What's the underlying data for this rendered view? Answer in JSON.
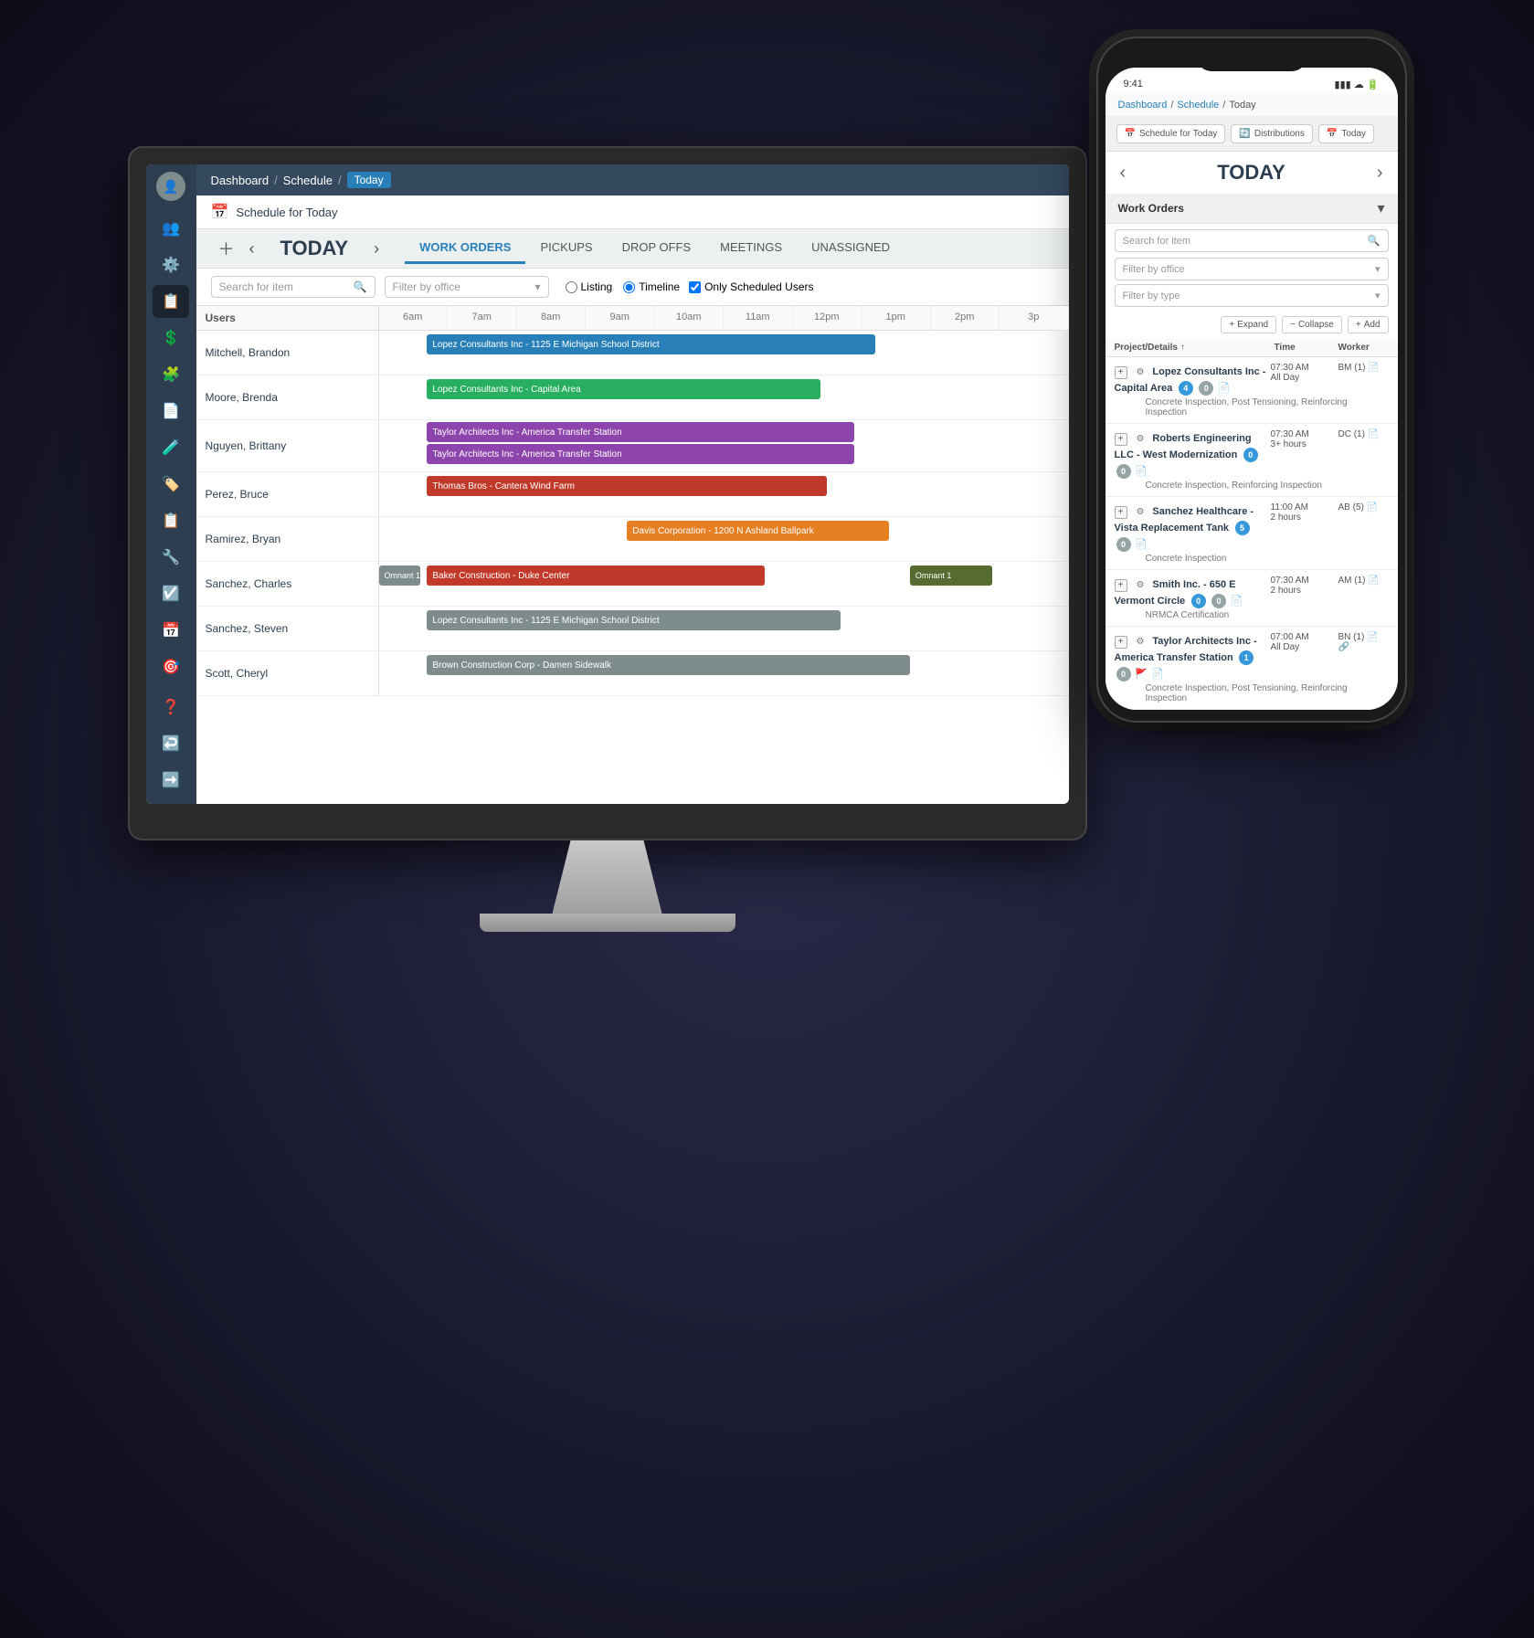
{
  "meta": {
    "bg_dark": "#1a1a2e"
  },
  "breadcrumb": {
    "home": "Dashboard",
    "section": "Schedule",
    "current": "Today",
    "sep": "/"
  },
  "schedule": {
    "title": "Schedule for Today",
    "today_label": "TODAY"
  },
  "nav_tabs": [
    {
      "label": "WORK ORDERS",
      "active": true
    },
    {
      "label": "PICKUPS",
      "active": false
    },
    {
      "label": "DROP OFFS",
      "active": false
    },
    {
      "label": "MEETINGS",
      "active": false
    },
    {
      "label": "UNASSIGNED",
      "active": false
    }
  ],
  "filters": {
    "search_placeholder": "Search for item",
    "office_placeholder": "Filter by office",
    "listing_label": "Listing",
    "timeline_label": "Timeline",
    "scheduled_users_label": "Only Scheduled Users"
  },
  "time_slots": [
    "6am",
    "7am",
    "8am",
    "9am",
    "10am",
    "11am",
    "12pm",
    "1pm",
    "2pm",
    "3p"
  ],
  "users_col_label": "Users",
  "timeline_rows": [
    {
      "user": "Mitchell, Brandon",
      "events": [
        {
          "label": "Lopez Consultants Inc - 1125 E Michigan School District",
          "color": "#2980b9",
          "left": "7%",
          "width": "65%"
        }
      ]
    },
    {
      "user": "Moore, Brenda",
      "events": [
        {
          "label": "Lopez Consultants Inc - Capital Area",
          "color": "#27ae60",
          "left": "7%",
          "width": "57%"
        }
      ]
    },
    {
      "user": "Nguyen, Brittany",
      "events": [
        {
          "label": "Taylor Architects Inc - America Transfer Station",
          "color": "#8e44ad",
          "left": "7%",
          "width": "62%"
        },
        {
          "label": "Taylor Architects Inc - America Transfer Station",
          "color": "#8e44ad",
          "left": "7%",
          "width": "62%",
          "row": 2
        }
      ]
    },
    {
      "user": "Perez, Bruce",
      "events": [
        {
          "label": "Thomas Bros - Cantera Wind Farm",
          "color": "#c0392b",
          "left": "7%",
          "width": "58%"
        }
      ]
    },
    {
      "user": "Ramirez, Bryan",
      "events": [
        {
          "label": "Davis Corporation - 1200 N Ashland Ballpark",
          "color": "#e67e22",
          "left": "36%",
          "width": "38%"
        }
      ]
    },
    {
      "user": "Sanchez, Charles",
      "events": [
        {
          "label": "Omnant 1",
          "color": "#7f8c8d",
          "left": "0%",
          "width": "6%"
        },
        {
          "label": "Baker Construction - Duke Center",
          "color": "#c0392b",
          "left": "7%",
          "width": "49%"
        },
        {
          "label": "Omnant 1",
          "color": "#7f8c8d",
          "left": "76%",
          "width": "10%"
        }
      ]
    },
    {
      "user": "Sanchez, Steven",
      "events": [
        {
          "label": "Lopez Consultants Inc - 1125 E Michigan School District",
          "color": "#7f8c8d",
          "left": "7%",
          "width": "60%"
        }
      ]
    },
    {
      "user": "Scott, Cheryl",
      "events": [
        {
          "label": "Brown Construction Corp - Damen Sidewalk",
          "color": "#7f8c8d",
          "left": "7%",
          "width": "70%"
        }
      ]
    }
  ],
  "phone": {
    "breadcrumb": [
      "Dashboard",
      "/",
      "Schedule",
      "/",
      "Today"
    ],
    "toolbar": {
      "schedule_btn": "Schedule for Today",
      "distributions_btn": "Distributions",
      "today_btn": "Today"
    },
    "today_title": "TODAY",
    "section": "Work Orders",
    "search_placeholder": "Search for item",
    "filter_office_placeholder": "Filter by office",
    "filter_type_placeholder": "Filter by type",
    "expand_btn": "Expand",
    "collapse_btn": "Collapse",
    "add_btn": "Add",
    "table_headers": [
      "Project/Details ↑",
      "Time",
      "Worker"
    ],
    "work_items": [
      {
        "project": "Lopez Consultants Inc - Capital Area",
        "badges": [
          {
            "val": "4",
            "color": "blue"
          },
          {
            "val": "0",
            "color": "gray"
          }
        ],
        "time": "07:30 AM\nAll Day",
        "worker": "BM (1)",
        "detail": "Concrete Inspection, Post Tensioning, Reinforcing Inspection",
        "has_gear": true,
        "has_expand": true,
        "has_doc": true
      },
      {
        "project": "Roberts Engineering LLC - West Modernization",
        "badges": [
          {
            "val": "0",
            "color": "blue"
          },
          {
            "val": "0",
            "color": "gray"
          }
        ],
        "time": "07:30 AM\n3+ hours",
        "worker": "DC (1)",
        "detail": "Concrete Inspection, Reinforcing Inspection",
        "has_gear": true,
        "has_expand": true,
        "has_doc": true
      },
      {
        "project": "Sanchez Healthcare - Vista Replacement Tank",
        "badges": [
          {
            "val": "5",
            "color": "blue"
          },
          {
            "val": "0",
            "color": "gray"
          }
        ],
        "time": "11:00 AM\n2 hours",
        "worker": "AB (5)",
        "detail": "Concrete Inspection",
        "has_gear": true,
        "has_expand": true,
        "has_doc": true
      },
      {
        "project": "Smith Inc. - 650 E Vermont Circle",
        "badges": [
          {
            "val": "0",
            "color": "blue"
          },
          {
            "val": "0",
            "color": "gray"
          }
        ],
        "time": "07:30 AM\n2 hours",
        "worker": "AM (1)",
        "detail": "NRMCA Certification",
        "has_gear": true,
        "has_expand": true,
        "has_doc": true
      },
      {
        "project": "Taylor Architects Inc - America Transfer Station",
        "badges": [
          {
            "val": "1",
            "color": "blue"
          },
          {
            "val": "0",
            "color": "gray"
          }
        ],
        "time": "07:00 AM\nAll Day",
        "worker": "BN (1)",
        "detail": "Concrete Inspection, Post Tensioning, Reinforcing Inspection",
        "has_gear": true,
        "has_expand": true,
        "has_doc": true,
        "has_flag": true,
        "has_link": true
      }
    ]
  },
  "sidebar_items": [
    {
      "icon": "👤",
      "name": "avatar",
      "active": false
    },
    {
      "icon": "👥",
      "name": "people",
      "active": false
    },
    {
      "icon": "⚙️",
      "name": "settings",
      "active": false
    },
    {
      "icon": "📋",
      "name": "tasks",
      "active": true
    },
    {
      "icon": "💵",
      "name": "billing",
      "active": false
    },
    {
      "icon": "🧩",
      "name": "integrations",
      "active": false
    },
    {
      "icon": "📄",
      "name": "documents",
      "active": false
    },
    {
      "icon": "🧪",
      "name": "labs",
      "active": false
    },
    {
      "icon": "🏷️",
      "name": "tags",
      "active": false
    },
    {
      "icon": "📋",
      "name": "reports",
      "active": false
    },
    {
      "icon": "🔧",
      "name": "tools",
      "active": false
    },
    {
      "icon": "☑️",
      "name": "checklist",
      "active": false
    },
    {
      "icon": "📅",
      "name": "calendar",
      "active": false
    },
    {
      "icon": "🎯",
      "name": "targeting",
      "active": false
    },
    {
      "icon": "❓",
      "name": "help",
      "active": false
    },
    {
      "icon": "↩️",
      "name": "back",
      "active": false
    },
    {
      "icon": "➡️",
      "name": "forward",
      "active": false
    }
  ]
}
